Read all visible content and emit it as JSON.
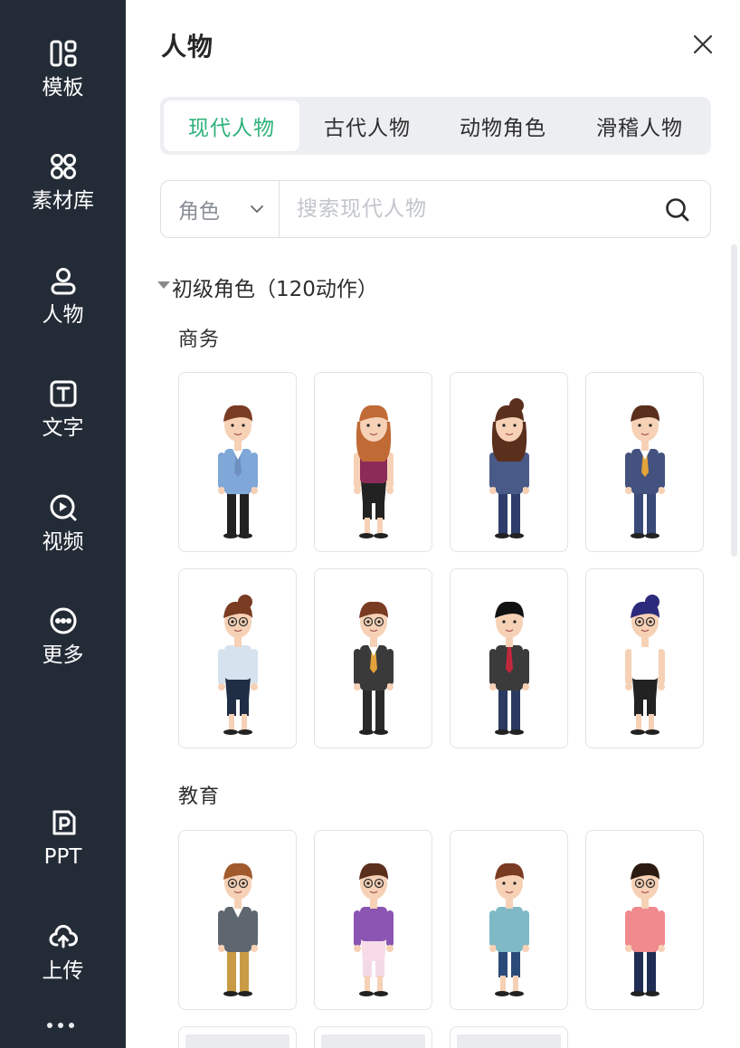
{
  "sidebar": {
    "items": [
      {
        "label": "模板",
        "icon": "template-icon"
      },
      {
        "label": "素材库",
        "icon": "material-library-icon"
      },
      {
        "label": "人物",
        "icon": "person-icon"
      },
      {
        "label": "文字",
        "icon": "text-icon"
      },
      {
        "label": "视频",
        "icon": "video-icon"
      },
      {
        "label": "更多",
        "icon": "more-icon"
      },
      {
        "label": "PPT",
        "icon": "ppt-icon"
      },
      {
        "label": "上传",
        "icon": "upload-icon"
      }
    ]
  },
  "panel": {
    "title": "人物",
    "tabs": [
      {
        "label": "现代人物",
        "active": true
      },
      {
        "label": "古代人物",
        "active": false
      },
      {
        "label": "动物角色",
        "active": false
      },
      {
        "label": "滑稽人物",
        "active": false
      }
    ],
    "search": {
      "filter_value": "角色",
      "placeholder": "搜索现代人物"
    },
    "group": {
      "title": "初级角色（120动作）",
      "sections": [
        {
          "label": "商务"
        },
        {
          "label": "教育"
        }
      ]
    }
  },
  "colors": {
    "sidebar_bg": "#232b36",
    "accent": "#2fb27a",
    "tab_bg": "#eceef1",
    "border": "#dcdfe4"
  }
}
